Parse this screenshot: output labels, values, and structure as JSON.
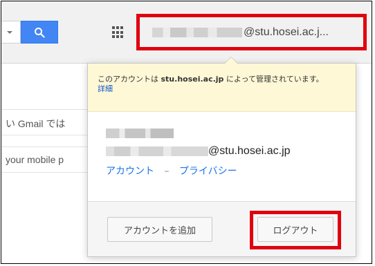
{
  "header": {
    "search_icon": "search-icon",
    "apps_icon": "apps-grid-icon",
    "account_email_suffix": "@stu.hosei.ac.j..."
  },
  "background": {
    "row1": "い Gmail では",
    "row2": "your mobile p"
  },
  "popup": {
    "notice_prefix": "このアカウントは",
    "notice_domain": "stu.hosei.ac.jp",
    "notice_suffix": "によって管理されています。",
    "notice_detail": "詳細",
    "email_suffix": "@stu.hosei.ac.jp",
    "link_account": "アカウント",
    "link_separator": "–",
    "link_privacy": "プライバシー",
    "add_account_label": "アカウントを追加",
    "logout_label": "ログアウト"
  },
  "colors": {
    "accent_blue": "#4285f4",
    "highlight_red": "#e0000f",
    "notice_bg": "#fff8d6"
  }
}
